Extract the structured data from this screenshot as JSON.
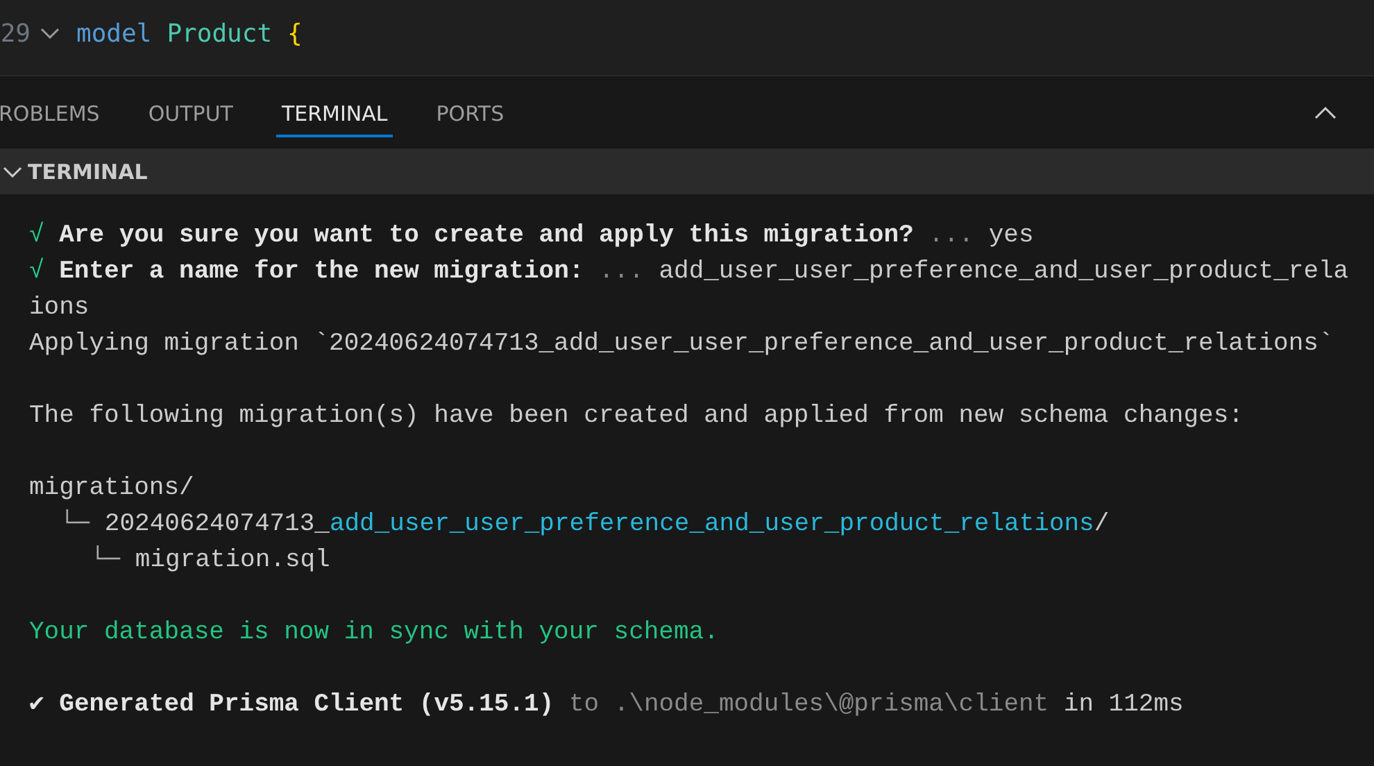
{
  "editor": {
    "lines": [
      {
        "number": "29",
        "foldable": true,
        "tokens": [
          {
            "kind": "keyword",
            "text": "model"
          },
          {
            "kind": "type",
            "text": "Product"
          },
          {
            "kind": "brace",
            "text": "{"
          }
        ]
      }
    ]
  },
  "panel": {
    "tabs": [
      {
        "label": "ROBLEMS",
        "selected": false
      },
      {
        "label": "OUTPUT",
        "selected": false
      },
      {
        "label": "TERMINAL",
        "selected": true
      },
      {
        "label": "PORTS",
        "selected": false
      }
    ],
    "section": {
      "title": "TERMINAL",
      "expanded": true
    },
    "lines": [
      {
        "kind": "text",
        "segments": [
          {
            "kind": "check",
            "text": "√"
          },
          {
            "kind": "bold",
            "text": "Are you sure you want to create and apply this migration?"
          },
          {
            "kind": "dim",
            "text": "..."
          },
          {
            "kind": "plain",
            "text": "yes"
          }
        ]
      },
      {
        "kind": "text",
        "segments": [
          {
            "kind": "check",
            "text": "√"
          },
          {
            "kind": "bold",
            "text": "Enter a name for the new migration:"
          },
          {
            "kind": "dim",
            "text": "..."
          },
          {
            "kind": "plain",
            "text": "add_user_user_preference_and_user_product_rela"
          }
        ]
      },
      {
        "kind": "text",
        "segments": [
          {
            "kind": "plain",
            "text": "ions"
          }
        ]
      },
      {
        "kind": "text",
        "segments": [
          {
            "kind": "plain",
            "text": "Applying migration `20240624074713_add_user_user_preference_and_user_product_relations`"
          }
        ]
      },
      {
        "kind": "blank"
      },
      {
        "kind": "text",
        "segments": [
          {
            "kind": "plain",
            "text": "The following migration(s) have been created and applied from new schema changes:"
          }
        ]
      },
      {
        "kind": "blank"
      },
      {
        "kind": "text",
        "segments": [
          {
            "kind": "plain",
            "text": "migrations/"
          }
        ],
        "children": [
          {
            "kind": "text",
            "segments": [
              {
                "kind": "tree",
                "text": "└─"
              },
              {
                "kind": "plain",
                "text": "20240624074713_"
              },
              {
                "kind": "link",
                "text": "add_user_user_preference_and_user_product_relations"
              },
              {
                "kind": "plain",
                "text": "/"
              }
            ],
            "children": [
              {
                "kind": "text",
                "segments": [
                  {
                    "kind": "tree",
                    "text": "└─"
                  },
                  {
                    "kind": "plain",
                    "text": "migration.sql"
                  }
                ]
              }
            ]
          }
        ]
      },
      {
        "kind": "blank"
      },
      {
        "kind": "text",
        "segments": [
          {
            "kind": "success",
            "text": "Your database is now in sync with your schema."
          }
        ]
      },
      {
        "kind": "blank"
      },
      {
        "kind": "text",
        "segments": [
          {
            "kind": "tick",
            "text": "✔"
          },
          {
            "kind": "bold",
            "text": "Generated Prisma Client (v5.15.1)"
          },
          {
            "kind": "dim",
            "text": "to .\\node_modules\\@prisma\\client"
          },
          {
            "kind": "plain",
            "text": "in 112ms"
          }
        ]
      }
    ]
  }
}
